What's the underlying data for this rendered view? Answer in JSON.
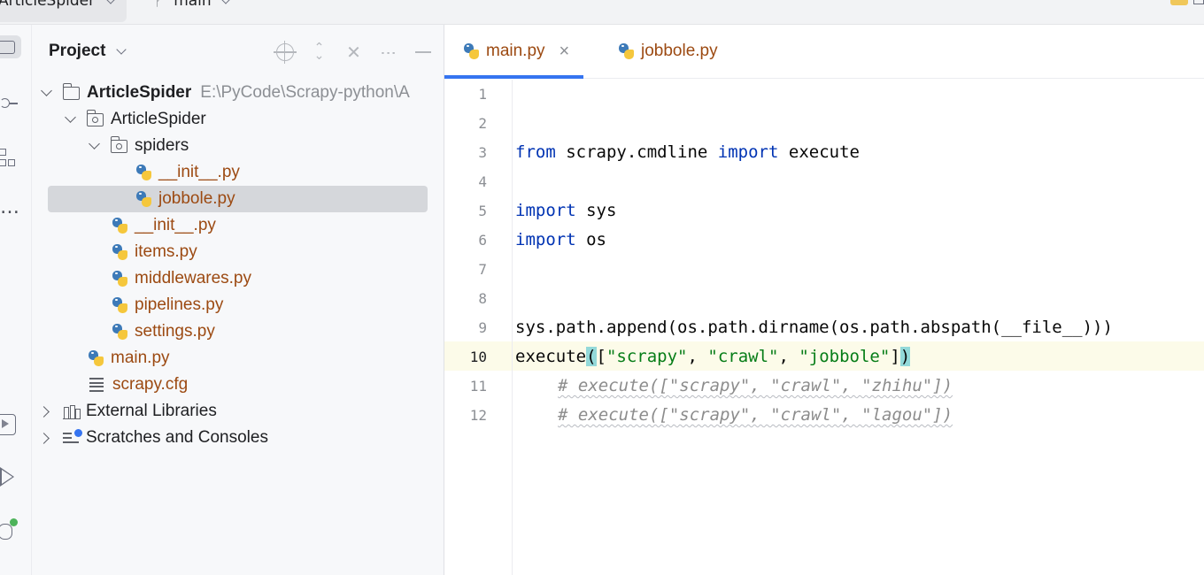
{
  "titlebar": {
    "project_name": "ArticleSpider",
    "branch": "main"
  },
  "sidebar_tools": [
    {
      "icon": "folder-icon",
      "label": "Project"
    },
    {
      "icon": "commit-icon",
      "label": "Commit"
    },
    {
      "icon": "structure-icon",
      "label": "Structure"
    },
    {
      "icon": "more-icon",
      "label": "More"
    },
    {
      "icon": "services-icon",
      "label": "Services"
    },
    {
      "icon": "run-icon",
      "label": "Run"
    },
    {
      "icon": "debug-icon",
      "label": "Debug"
    }
  ],
  "project_panel": {
    "title": "Project",
    "tree": [
      {
        "label": "ArticleSpider",
        "path": "E:\\PyCode\\Scrapy-python\\A",
        "type": "root-folder"
      },
      {
        "label": "ArticleSpider",
        "type": "package"
      },
      {
        "label": "spiders",
        "type": "package"
      },
      {
        "label": "__init__.py",
        "type": "python"
      },
      {
        "label": "jobbole.py",
        "type": "python",
        "selected": true
      },
      {
        "label": "__init__.py",
        "type": "python"
      },
      {
        "label": "items.py",
        "type": "python"
      },
      {
        "label": "middlewares.py",
        "type": "python"
      },
      {
        "label": "pipelines.py",
        "type": "python"
      },
      {
        "label": "settings.py",
        "type": "python"
      },
      {
        "label": "main.py",
        "type": "python"
      },
      {
        "label": "scrapy.cfg",
        "type": "config"
      },
      {
        "label": "External Libraries",
        "type": "library"
      },
      {
        "label": "Scratches and Consoles",
        "type": "scratches"
      }
    ]
  },
  "editor": {
    "tabs": [
      {
        "label": "main.py",
        "active": true
      },
      {
        "label": "jobbole.py",
        "active": false
      }
    ],
    "line_numbers": [
      "1",
      "2",
      "3",
      "4",
      "5",
      "6",
      "7",
      "8",
      "9",
      "10",
      "11",
      "12"
    ],
    "current_line": "10",
    "lines": {
      "l3_kw1": "from",
      "l3_mod": " scrapy.cmdline ",
      "l3_kw2": "import",
      "l3_name": " execute",
      "l5_kw": "import",
      "l5_name": " sys",
      "l6_kw": "import",
      "l6_name": " os",
      "l9": "sys.path.append(os.path.dirname(os.path.abspath(__file__)))",
      "l10_fn": "execute",
      "l10_open": "(",
      "l10_list_open": "[",
      "l10_s1": "\"scrapy\"",
      "l10_sep1": ", ",
      "l10_s2": "\"crawl\"",
      "l10_sep2": ", ",
      "l10_s3": "\"jobbole\"",
      "l10_list_close": "]",
      "l10_close": ")",
      "l11": "# execute([\"scrapy\", \"crawl\", \"zhihu\"])",
      "l12": "# execute([\"scrapy\", \"crawl\", \"lagou\"])"
    }
  }
}
